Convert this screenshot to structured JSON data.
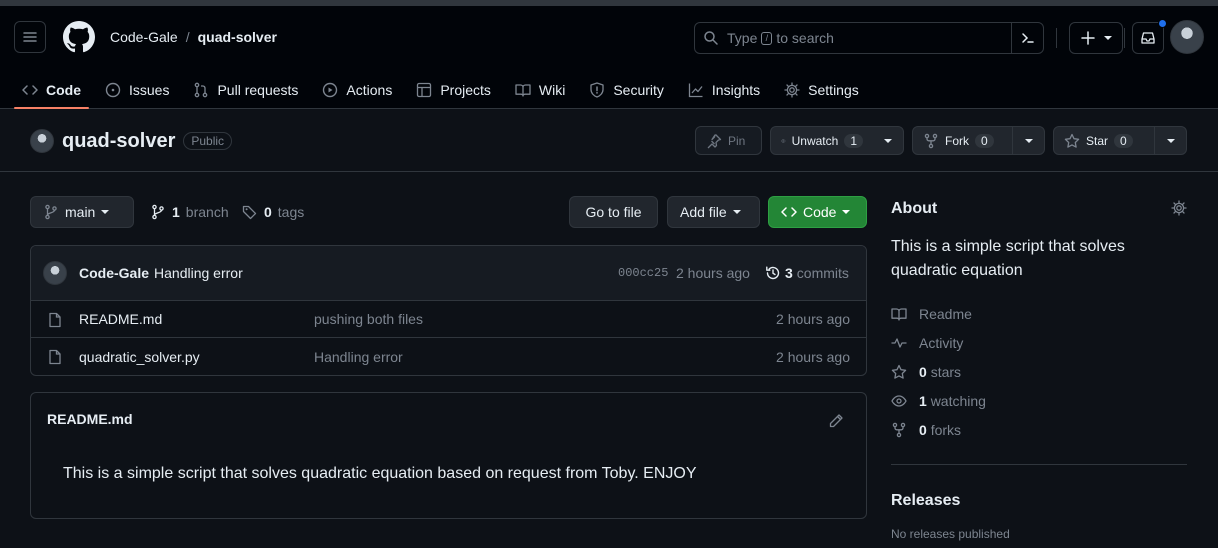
{
  "header": {
    "owner": "Code-Gale",
    "separator": "/",
    "repo": "quad-solver",
    "search": {
      "prefix": "Type",
      "key": "/",
      "suffix": "to search"
    }
  },
  "tabs": [
    {
      "label": "Code",
      "icon": "code-icon",
      "active": true
    },
    {
      "label": "Issues",
      "icon": "issue-icon"
    },
    {
      "label": "Pull requests",
      "icon": "pull-request-icon"
    },
    {
      "label": "Actions",
      "icon": "play-icon"
    },
    {
      "label": "Projects",
      "icon": "table-icon"
    },
    {
      "label": "Wiki",
      "icon": "book-icon"
    },
    {
      "label": "Security",
      "icon": "shield-icon"
    },
    {
      "label": "Insights",
      "icon": "graph-icon"
    },
    {
      "label": "Settings",
      "icon": "gear-icon"
    }
  ],
  "repo_header": {
    "name": "quad-solver",
    "visibility": "Public",
    "pin": "Pin",
    "unwatch": "Unwatch",
    "watch_count": "1",
    "fork": "Fork",
    "fork_count": "0",
    "star": "Star",
    "star_count": "0"
  },
  "toolbar": {
    "branch": "main",
    "branch_count": "1",
    "branch_label": "branch",
    "tag_count": "0",
    "tag_label": "tags",
    "go_to_file": "Go to file",
    "add_file": "Add file",
    "code": "Code"
  },
  "latest_commit": {
    "author": "Code-Gale",
    "message": "Handling error",
    "sha": "000cc25",
    "time": "2 hours ago",
    "commit_count": "3",
    "commit_label": "commits"
  },
  "files": [
    {
      "name": "README.md",
      "message": "pushing both files",
      "time": "2 hours ago"
    },
    {
      "name": "quadratic_solver.py",
      "message": "Handling error",
      "time": "2 hours ago"
    }
  ],
  "readme": {
    "title": "README.md",
    "text": "This is a simple script that solves quadratic equation based on request from Toby. ENJOY"
  },
  "about": {
    "title": "About",
    "description": "This is a simple script that solves quadratic equation",
    "readme": "Readme",
    "activity": "Activity",
    "stars_count": "0",
    "stars_label": "stars",
    "watching_count": "1",
    "watching_label": "watching",
    "forks_count": "0",
    "forks_label": "forks"
  },
  "releases": {
    "title": "Releases",
    "empty": "No releases published"
  },
  "colors": {
    "background": "#0d1117",
    "accent_tab": "#f78166",
    "green_button": "#238636",
    "notification_dot": "#1f6feb"
  }
}
